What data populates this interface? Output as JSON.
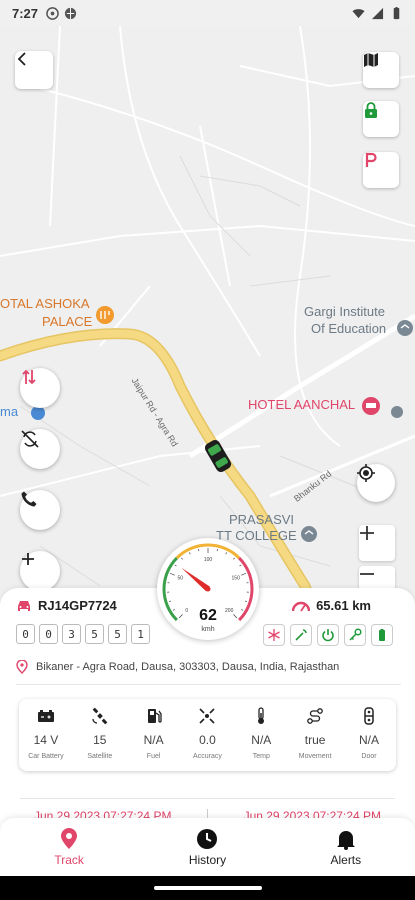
{
  "status_bar": {
    "time": "7:27"
  },
  "map": {
    "labels": {
      "hotel_ashoka_line1": "OTAL ASHOKA",
      "hotel_ashoka_line2": "PALACE",
      "gargi_line1": "Gargi Institute",
      "gargi_line2": "Of Education",
      "hotel_aanchal": "HOTEL AANCHAL",
      "prasasvi_line1": "PRASASVI",
      "prasasvi_line2": "TT COLLEGE",
      "left_edge": "ma",
      "road_jaipur_agra": "Jaipur Rd - Agra Rd",
      "road_bhanku": "Bhanku Rd"
    }
  },
  "vehicle": {
    "plate": "RJ14GP7724",
    "odometer_digits": [
      "0",
      "0",
      "3",
      "5",
      "5",
      "1"
    ],
    "distance": "65.61 km",
    "address": "Bikaner - Agra Road, Dausa, 303303, Dausa, India, Rajasthan"
  },
  "speedometer": {
    "speed": "62",
    "unit": "kmh",
    "ticks": [
      "0",
      "50",
      "100",
      "150",
      "200"
    ],
    "needle_value": 62,
    "max": 200
  },
  "stats": [
    {
      "value": "14 V",
      "label": "Car Battery",
      "icon": "car-battery-icon"
    },
    {
      "value": "15",
      "label": "Satellite",
      "icon": "satellite-icon"
    },
    {
      "value": "N/A",
      "label": "Fuel",
      "icon": "fuel-icon"
    },
    {
      "value": "0.0",
      "label": "Accuracy",
      "icon": "accuracy-icon"
    },
    {
      "value": "N/A",
      "label": "Temp",
      "icon": "temp-icon"
    },
    {
      "value": "true",
      "label": "Movement",
      "icon": "movement-icon"
    },
    {
      "value": "N/A",
      "label": "Door",
      "icon": "door-icon"
    }
  ],
  "timestamps": {
    "left": "Jun 29,2023 07:27:24 PM",
    "right": "Jun 29,2023 07:27:24 PM"
  },
  "nav": {
    "track": "Track",
    "history": "History",
    "alerts": "Alerts"
  },
  "colors": {
    "accent": "#e0456a",
    "road_major": "#f3d27a",
    "lock_green": "#1f9a3a"
  }
}
